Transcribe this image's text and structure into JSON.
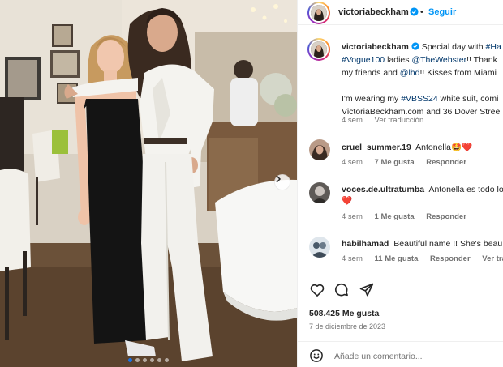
{
  "post": {
    "username": "victoriabeckham",
    "follow_label": "Seguir",
    "more_label": "•••",
    "caption": {
      "line1_prefix": "Special day with ",
      "line1_tag": "#Ha",
      "line2_tag1": "#Vogue100",
      "line2_mid": " ladies ",
      "line2_tag2": "@TheWebster",
      "line2_suffix": "!! Thank",
      "line3_prefix": "my friends and ",
      "line3_tag": "@lhd",
      "line3_suffix": "!! Kisses from Miami",
      "line4_prefix": "I'm wearing my ",
      "line4_tag": "#VBSS24",
      "line4_suffix": " white suit, comi",
      "line5": "VictoriaBeckham.com and 36 Dover Stree"
    },
    "caption_meta": {
      "time": "4 sem",
      "translate": "Ver traducción"
    },
    "comments": [
      {
        "user": "cruel_summer.19",
        "text": "Antonella🤩❤️",
        "time": "4 sem",
        "likes": "7 Me gusta",
        "reply": "Responder"
      },
      {
        "user": "voces.de.ultratumba",
        "text": "Antonella es todo lo",
        "text2": "❤️",
        "time": "4 sem",
        "likes": "1 Me gusta",
        "reply": "Responder"
      },
      {
        "user": "habilhamad",
        "text": "Beautiful name !! She's beau",
        "time": "4 sem",
        "likes": "11 Me gusta",
        "reply": "Responder",
        "translate": "Ver traducci"
      }
    ],
    "likes_count": "508.425 Me gusta",
    "date": "7 de diciembre de 2023",
    "comment_placeholder": "Añade un comentario...",
    "carousel": {
      "slides": 6,
      "active": 0
    }
  },
  "icons": {
    "verified": "verified-badge-icon",
    "like": "heart-icon",
    "comment": "comment-icon",
    "share": "share-icon",
    "emoji": "emoji-icon",
    "next": "chevron-right-icon"
  },
  "colors": {
    "link": "#0095f6",
    "tag": "#00376b",
    "muted": "#737373",
    "verified": "#0095f6"
  }
}
